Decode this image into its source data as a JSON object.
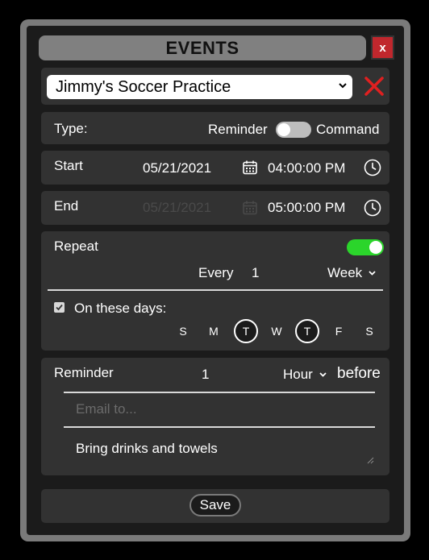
{
  "title": "EVENTS",
  "close_label": "x",
  "event_select": {
    "value": "Jimmy's Soccer Practice"
  },
  "type": {
    "label": "Type:",
    "option_left": "Reminder",
    "option_right": "Command"
  },
  "start": {
    "label": "Start",
    "date": "05/21/2021",
    "time": "04:00:00 PM"
  },
  "end": {
    "label": "End",
    "date": "05/21/2021",
    "time": "05:00:00 PM"
  },
  "repeat": {
    "label": "Repeat",
    "every_label": "Every",
    "every_value": "1",
    "unit": "Week",
    "on_days_label": "On these days:",
    "days": [
      {
        "label": "S",
        "selected": false
      },
      {
        "label": "M",
        "selected": false
      },
      {
        "label": "T",
        "selected": true
      },
      {
        "label": "W",
        "selected": false
      },
      {
        "label": "T",
        "selected": true
      },
      {
        "label": "F",
        "selected": false
      },
      {
        "label": "S",
        "selected": false
      }
    ]
  },
  "reminder": {
    "label": "Reminder",
    "value": "1",
    "unit": "Hour",
    "suffix": "before",
    "email_placeholder": "Email to...",
    "note": "Bring drinks and towels"
  },
  "save_label": "Save",
  "colors": {
    "accent_green": "#2bd52b",
    "danger_red": "#c0272d",
    "card_bg": "#323232"
  }
}
